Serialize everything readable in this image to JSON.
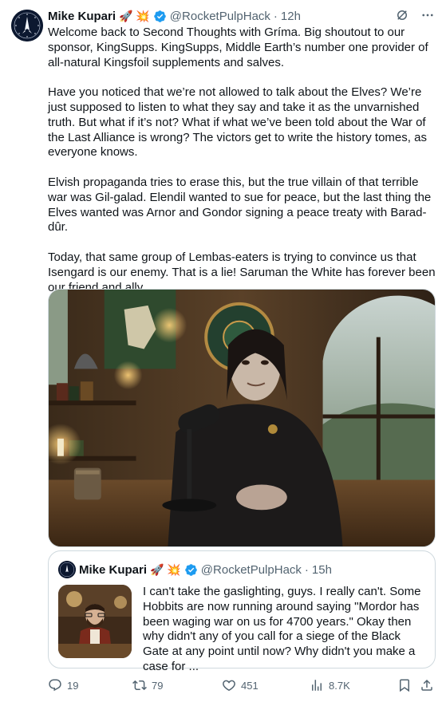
{
  "tweet": {
    "author_name": "Mike Kupari",
    "emojis": "🚀 💥",
    "handle": "@RocketPulpHack",
    "separator": "·",
    "time": "12h",
    "paragraphs": [
      "Welcome back to Second Thoughts with Gríma. Big shoutout to our sponsor, KingSupps. KingSupps, Middle Earth’s number one provider of all-natural Kingsfoil supplements and salves.",
      "Have you noticed that we’re not allowed to talk about the Elves? We’re just supposed to listen to what they say and take it as the unvarnished truth. But what if it’s not? What if what we’ve been told about the War of the Last Alliance is wrong? The victors get to write the history tomes, as everyone knows.",
      "Elvish propaganda tries to erase this, but the true villain of that terrible war was Gil-galad. Elendil wanted to sue for peace, but the last thing the Elves wanted was Arnor and Gondor signing a peace treaty with Barad-dûr.",
      "Today, that same group of Lembas-eaters is trying to convince us that Isengard is our enemy. That is a lie! Saruman the White has forever been our friend and ally."
    ]
  },
  "quote": {
    "author_name": "Mike Kupari",
    "emojis": "🚀 💥",
    "handle": "@RocketPulpHack",
    "separator": "·",
    "time": "15h",
    "text": "I can't take the gaslighting, guys. I really can't. Some Hobbits are now running around saying \"Mordor has been waging war on us for 4700 years.\" Okay then why didn't any of you call for a siege of the Black Gate at any point until now? Why didn't you make a case for ..."
  },
  "actions": {
    "replies": "19",
    "retweets": "79",
    "likes": "451",
    "views": "8.7K"
  },
  "icons": {
    "top": [
      "grok-icon",
      "more-icon"
    ],
    "actions": [
      "reply-icon",
      "retweet-icon",
      "like-icon",
      "views-icon",
      "bookmark-icon",
      "share-icon"
    ]
  },
  "colors": {
    "text": "#0f1419",
    "secondary": "#536471",
    "verified": "#1d9bf0",
    "border": "#cfd9de"
  }
}
